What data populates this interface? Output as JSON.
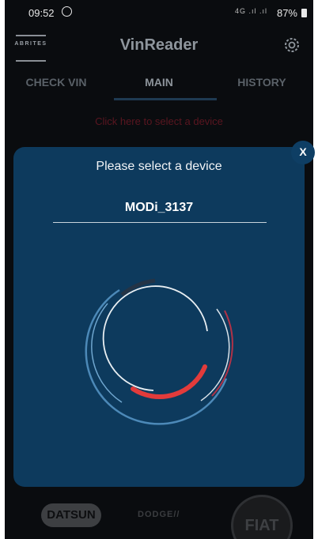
{
  "status_bar": {
    "time": "09:52",
    "signals": "4G .ıl .ıl",
    "battery": "87%"
  },
  "app": {
    "logo_text": "ABRITES",
    "title": "VinReader"
  },
  "tabs": [
    {
      "label": "CHECK VIN"
    },
    {
      "label": "MAIN",
      "selected": true
    },
    {
      "label": "HISTORY"
    }
  ],
  "select_device_link": "Click here to select a device",
  "modal": {
    "title": "Please select a device",
    "device": "MODi_3137",
    "close_label": "X"
  },
  "brands": {
    "datsun": "DATSUN",
    "dodge": "DODGE//",
    "fiat": "FIAT"
  },
  "colors": {
    "accent_red": "#e23b3b",
    "modal_bg": "#0d3a5d",
    "spinner_blue": "#4c89b8"
  }
}
